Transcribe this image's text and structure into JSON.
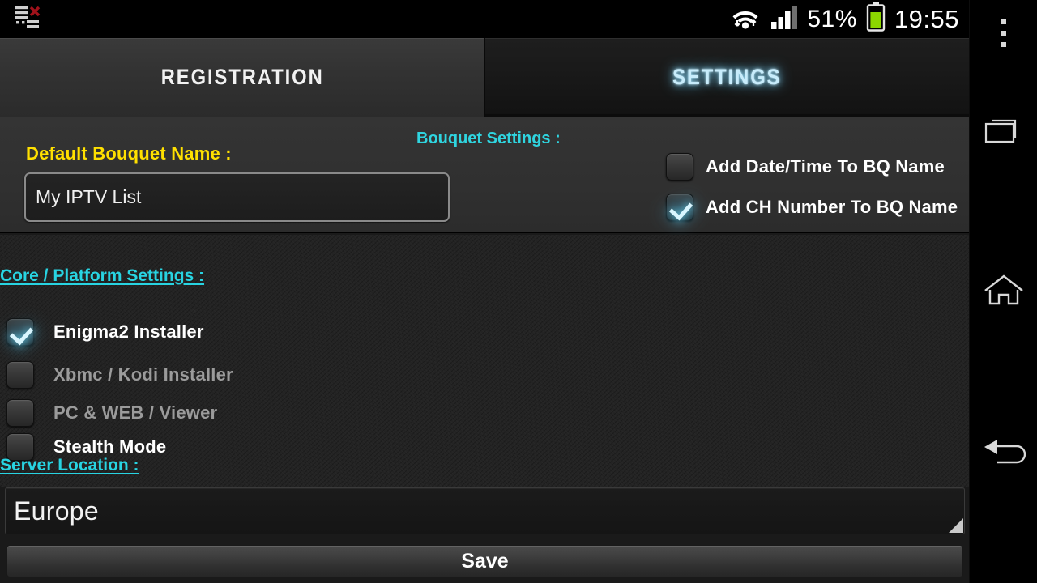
{
  "statusbar": {
    "notification_icon": "playlist-error-icon",
    "wifi_icon": "wifi-transfer-icon",
    "signal_icon": "cellular-signal-icon",
    "battery_percent": "51%",
    "battery_icon": "battery-icon",
    "clock": "19:55"
  },
  "tabs": [
    {
      "label": "REGISTRATION",
      "active": false
    },
    {
      "label": "SETTINGS",
      "active": true
    }
  ],
  "bouquet": {
    "default_name_label": "Default Bouquet Name :",
    "default_name_value": "My IPTV List",
    "default_name_placeholder": "My IPTV List",
    "section_label": "Bouquet Settings :",
    "options": [
      {
        "label": "Add Date/Time To BQ Name",
        "checked": false
      },
      {
        "label": "Add CH Number To BQ Name",
        "checked": true
      }
    ]
  },
  "core": {
    "section_label": "Core / Platform Settings :",
    "options": [
      {
        "label": "Enigma2 Installer",
        "checked": true,
        "enabled": true
      },
      {
        "label": "Xbmc / Kodi Installer",
        "checked": false,
        "enabled": false
      },
      {
        "label": "PC & WEB / Viewer",
        "checked": false,
        "enabled": false
      },
      {
        "label": "Stealth Mode",
        "checked": false,
        "enabled": true
      }
    ]
  },
  "server": {
    "section_label": "Server Location :",
    "selected": "Europe"
  },
  "save": {
    "label": "Save"
  },
  "navbar": {
    "items": [
      {
        "icon": "overflow-menu-icon"
      },
      {
        "icon": "recent-apps-icon"
      },
      {
        "icon": "home-icon"
      },
      {
        "icon": "back-icon"
      }
    ]
  },
  "colors": {
    "accent_cyan": "#28d4e2",
    "accent_yellow": "#ffe000",
    "tab_active_glow": "#c8ecfb",
    "battery_green": "#8cd600"
  }
}
